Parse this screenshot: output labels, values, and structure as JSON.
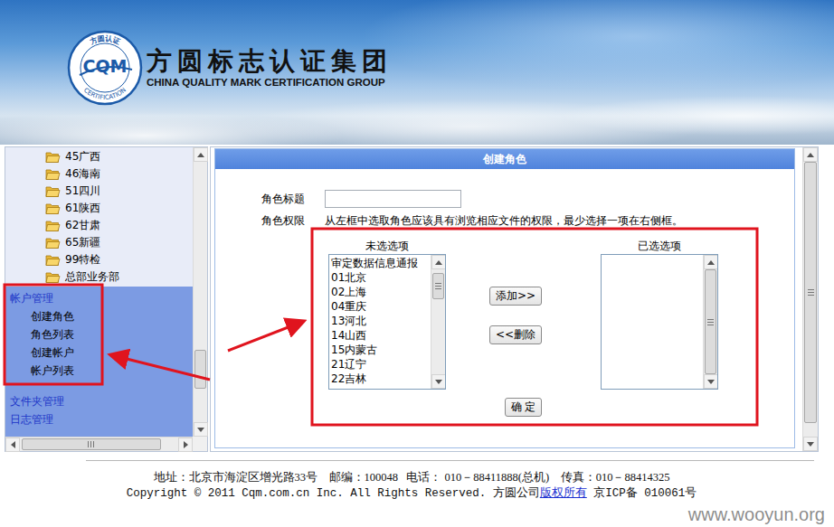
{
  "header": {
    "logo": {
      "abbr": "CQM",
      "ring_top": "方圆认证",
      "ring_bottom": "CERTIFICATION"
    },
    "title": "方圆标志认证集团",
    "subtitle": "CHINA QUALITY MARK CERTIFICATION GROUP"
  },
  "sidebar": {
    "tree": [
      {
        "label": "45广西"
      },
      {
        "label": "46海南"
      },
      {
        "label": "51四川"
      },
      {
        "label": "61陕西"
      },
      {
        "label": "62甘肃"
      },
      {
        "label": "65新疆"
      },
      {
        "label": "99特检"
      },
      {
        "label": "总部业务部"
      }
    ],
    "menus": [
      {
        "label": "帐户管理",
        "expanded": true,
        "items": [
          "创建角色",
          "角色列表",
          "创建帐户",
          "帐户列表"
        ]
      },
      {
        "label": "文件夹管理",
        "expanded": false,
        "items": []
      },
      {
        "label": "日志管理",
        "expanded": false,
        "items": []
      }
    ],
    "vscroll": {
      "position": 0.85,
      "size": 0.15
    },
    "hscroll": {
      "position": 0.08,
      "size": 0.88
    }
  },
  "form": {
    "title": "创建角色",
    "title_field": {
      "label": "角色标题",
      "value": ""
    },
    "permission": {
      "label": "角色权限",
      "hint": "从左框中选取角色应该具有浏览相应文件的权限，最少选择一项在右侧框。"
    },
    "available": {
      "caption": "未选选项",
      "items": [
        "审定数据信息通报",
        "01北京",
        "02上海",
        "04重庆",
        "13河北",
        "14山西",
        "15内蒙古",
        "21辽宁",
        "22吉林"
      ],
      "scroll": {
        "position": 0.05,
        "size": 0.25
      }
    },
    "chosen": {
      "caption": "已选选项",
      "items": []
    },
    "add_button": "添加>>",
    "remove_button": "<<删除",
    "submit_button": "确 定",
    "vscroll": {
      "position": 0.02,
      "size": 0.95
    }
  },
  "footer": {
    "address": "地址：北京市海淀区增光路33号    邮编：100048   电话： 010－88411888(总机)    传真：010－88414325",
    "copyright_prefix": "Copyright © 2011 Cqm.com.cn Inc. All Rights Reserved. 方圆公司",
    "copyright_link": "版权所有",
    "copyright_suffix": " 京ICP备 010061号"
  },
  "watermark": "www.wooyun.org"
}
